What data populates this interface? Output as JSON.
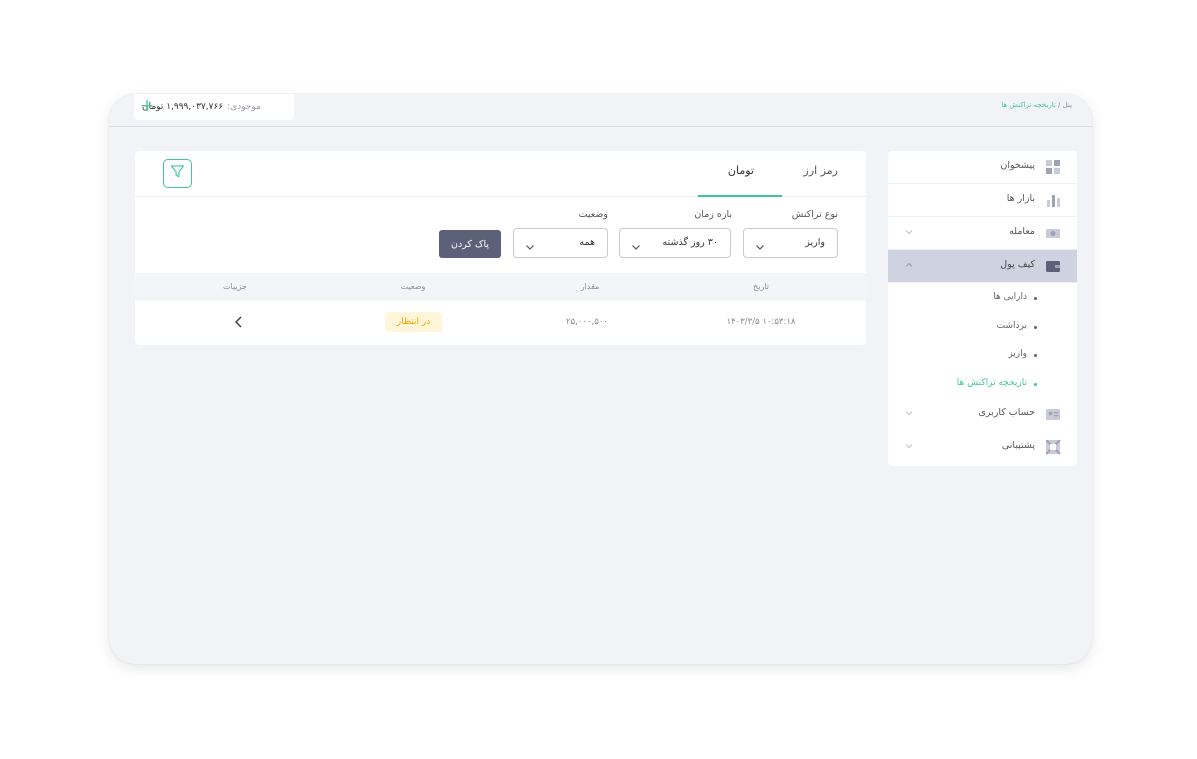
{
  "header": {
    "breadcrumb_root": "پنل",
    "breadcrumb_sep": "/",
    "breadcrumb_current": "تاریخچه تراکنش ها",
    "balance_label": "موجودی:",
    "balance_value": "۱,۹۹۹,۰۳۷,۷۶۶ تومان",
    "add_label": "+"
  },
  "sidebar": {
    "items": [
      {
        "label": "پیشخوان",
        "icon": "dashboard-icon"
      },
      {
        "label": "بازار ها",
        "icon": "chart-bars-icon"
      },
      {
        "label": "معامله",
        "icon": "exchange-icon",
        "expandable": true
      },
      {
        "label": "کیف پول",
        "icon": "wallet-icon",
        "expandable": true,
        "active": true
      },
      {
        "label": "حساب کاربری",
        "icon": "id-card-icon",
        "expandable": true
      },
      {
        "label": "پشتیبانی",
        "icon": "support-icon",
        "expandable": true
      }
    ],
    "wallet_sub": [
      {
        "label": "دارایی ها"
      },
      {
        "label": "برداشت"
      },
      {
        "label": "واریز"
      },
      {
        "label": "تاریخچه تراکنش ها",
        "current": true
      }
    ]
  },
  "tabs": {
    "crypto": "رمز ارز",
    "toman": "تومان"
  },
  "filters": {
    "type_label": "نوع تراکنش",
    "type_value": "واریز",
    "period_label": "بازه زمان",
    "period_value": "۳۰ روز گذشته",
    "status_label": "وضعیت",
    "status_value": "همه",
    "clear_label": "پاک کردن"
  },
  "table": {
    "headers": {
      "date": "تاریخ",
      "amount": "مقدار",
      "status": "وضعیت",
      "details": "جزییات"
    },
    "rows": [
      {
        "date": "۱۴۰۳/۳/۵ ۱۰:۵۳:۱۸",
        "amount": "۲۵,۰۰۰,۵۰۰",
        "status": "در انتظار"
      }
    ]
  },
  "colors": {
    "accent": "#3fc6a0",
    "pending_text": "#f0a500",
    "pending_bg": "#fff6d9",
    "button_dark": "#5c6078",
    "active_item_bg": "#cfd2e0"
  }
}
